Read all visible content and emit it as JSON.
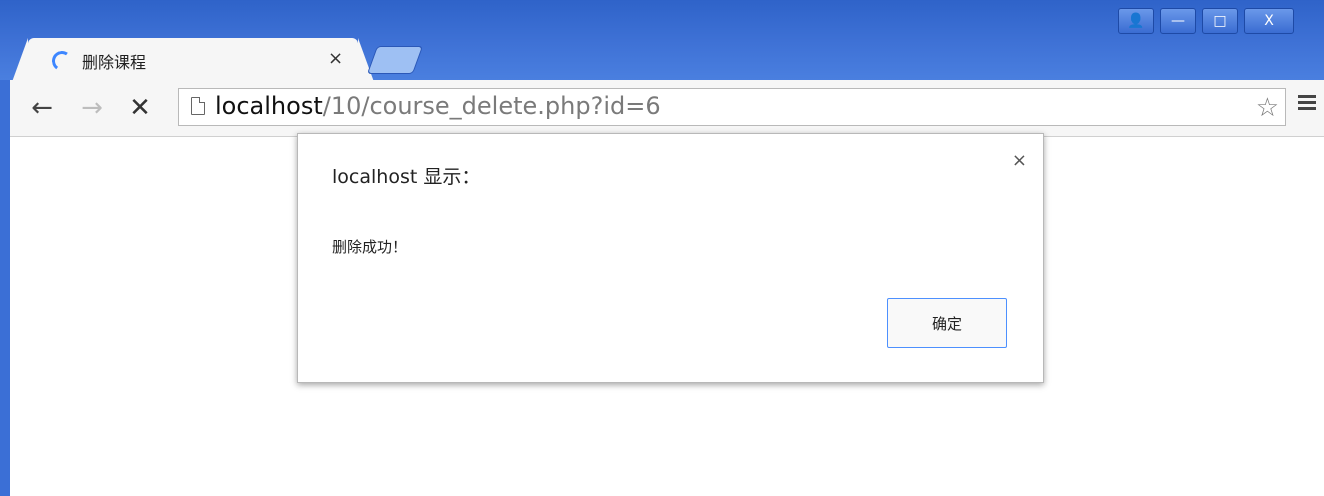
{
  "browser": {
    "tab": {
      "title": "删除课程",
      "close_glyph": "×"
    },
    "window_controls": {
      "profile": "👤",
      "minimize": "—",
      "maximize": "□",
      "close": "X"
    },
    "nav": {
      "back": "←",
      "forward": "→",
      "stop": "✕"
    },
    "address": {
      "host": "localhost",
      "path": "/10/course_delete.php?id=6"
    },
    "star": "☆"
  },
  "alert": {
    "title": "localhost 显示：",
    "message": "删除成功！",
    "ok_label": "确定",
    "close_glyph": "×"
  }
}
